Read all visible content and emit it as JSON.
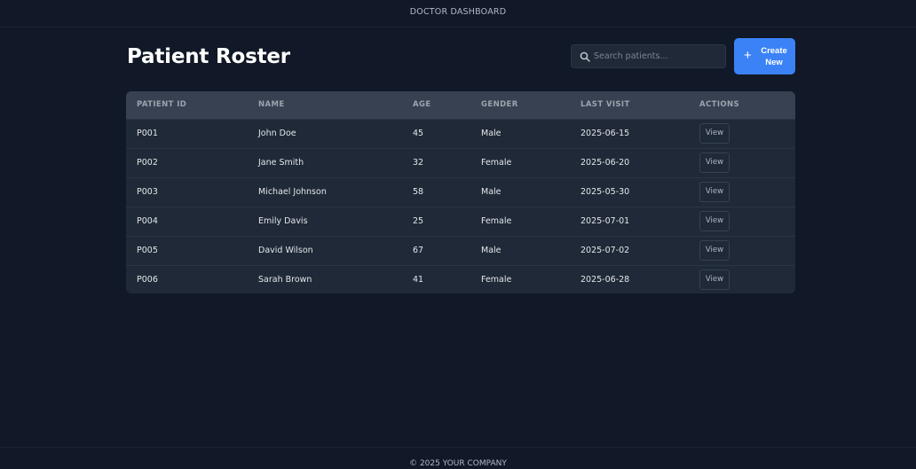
{
  "topbar": {
    "title": "DOCTOR DASHBOARD"
  },
  "header": {
    "title": "Patient Roster",
    "search_placeholder": "Search patients...",
    "create_label_line1": "Create",
    "create_label_line2": "New",
    "create_icon": "+"
  },
  "table": {
    "columns": [
      "PATIENT ID",
      "NAME",
      "AGE",
      "GENDER",
      "LAST VISIT",
      "ACTIONS"
    ],
    "rows": [
      {
        "id": "P001",
        "name": "John Doe",
        "age": "45",
        "gender": "Male",
        "last_visit": "2025-06-15",
        "action": "View"
      },
      {
        "id": "P002",
        "name": "Jane Smith",
        "age": "32",
        "gender": "Female",
        "last_visit": "2025-06-20",
        "action": "View"
      },
      {
        "id": "P003",
        "name": "Michael Johnson",
        "age": "58",
        "gender": "Male",
        "last_visit": "2025-05-30",
        "action": "View"
      },
      {
        "id": "P004",
        "name": "Emily Davis",
        "age": "25",
        "gender": "Female",
        "last_visit": "2025-07-01",
        "action": "View"
      },
      {
        "id": "P005",
        "name": "David Wilson",
        "age": "67",
        "gender": "Male",
        "last_visit": "2025-07-02",
        "action": "View"
      },
      {
        "id": "P006",
        "name": "Sarah Brown",
        "age": "41",
        "gender": "Female",
        "last_visit": "2025-06-28",
        "action": "View"
      }
    ]
  },
  "footer": {
    "text": "© 2025 YOUR COMPANY"
  },
  "colors": {
    "background": "#111827",
    "card": "#1f2937",
    "table_header": "#374151",
    "accent": "#3b82f6"
  },
  "icons": {
    "search": "search-icon",
    "create": "plus-icon"
  }
}
